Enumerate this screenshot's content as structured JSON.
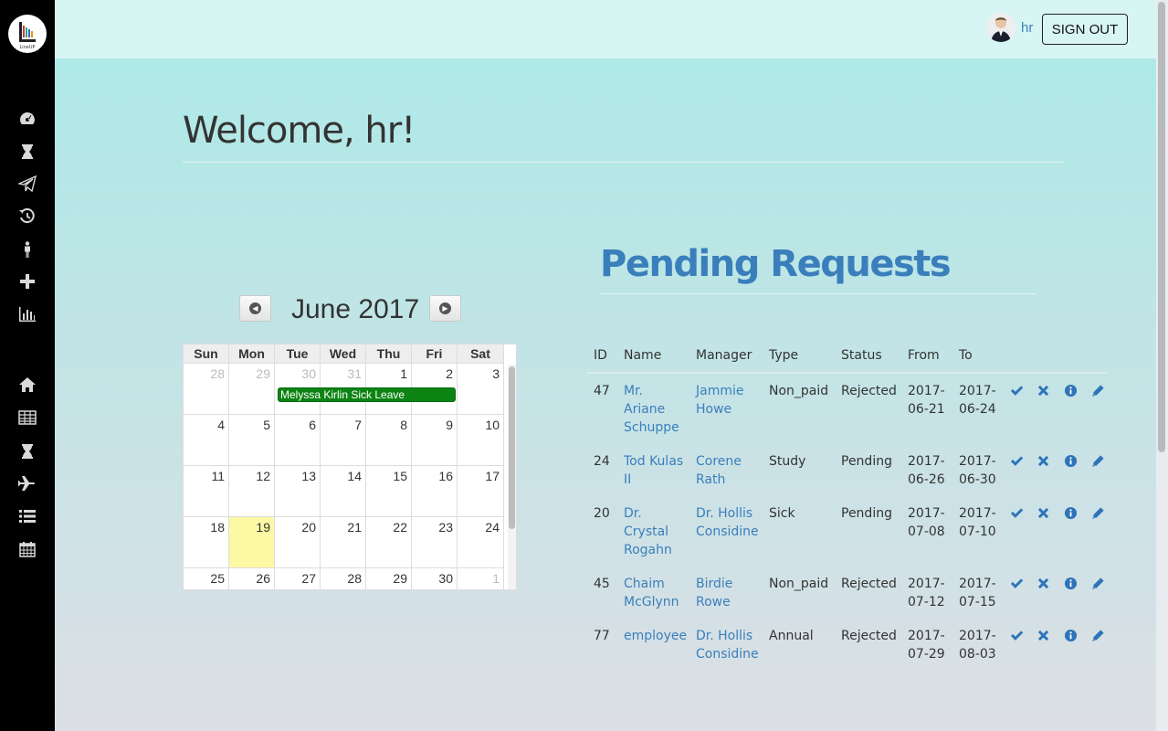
{
  "header": {
    "user_name": "hr",
    "sign_out_label": "SIGN OUT"
  },
  "sidebar": {
    "icons_top": [
      "dashboard-icon",
      "hourglass-icon",
      "paper-plane-icon",
      "history-icon",
      "person-icon",
      "plus-icon",
      "bar-chart-icon"
    ],
    "icons_bottom": [
      "home-icon",
      "table-icon",
      "hourglass-icon",
      "plane-icon",
      "list-icon",
      "calendar-icon"
    ]
  },
  "main": {
    "welcome": "Welcome, hr!"
  },
  "calendar": {
    "title": "June 2017",
    "weekdays": [
      "Sun",
      "Mon",
      "Tue",
      "Wed",
      "Thu",
      "Fri",
      "Sat"
    ],
    "weeks": [
      [
        "28",
        "29",
        "30",
        "31",
        "1",
        "2",
        "3"
      ],
      [
        "4",
        "5",
        "6",
        "7",
        "8",
        "9",
        "10"
      ],
      [
        "11",
        "12",
        "13",
        "14",
        "15",
        "16",
        "17"
      ],
      [
        "18",
        "19",
        "20",
        "21",
        "22",
        "23",
        "24"
      ],
      [
        "25",
        "26",
        "27",
        "28",
        "29",
        "30",
        "1"
      ]
    ],
    "event": "Melyssa Kirlin Sick Leave",
    "event_color": "#0c8313",
    "today_color": "#fcf8a4"
  },
  "pending": {
    "title": "Pending Requests",
    "columns": [
      "ID",
      "Name",
      "Manager",
      "Type",
      "Status",
      "From",
      "To"
    ],
    "rows": [
      {
        "id": "47",
        "name": [
          "Mr.",
          "Ariane",
          "Schuppe"
        ],
        "manager": [
          "Jammie",
          "Howe"
        ],
        "type": "Non_paid",
        "status": "Rejected",
        "from": [
          "2017-",
          "06-21"
        ],
        "to": [
          "2017-",
          "06-24"
        ]
      },
      {
        "id": "24",
        "name": [
          "Tod Kulas",
          "II"
        ],
        "manager": [
          "Corene",
          "Rath"
        ],
        "type": "Study",
        "status": "Pending",
        "from": [
          "2017-",
          "06-26"
        ],
        "to": [
          "2017-",
          "06-30"
        ]
      },
      {
        "id": "20",
        "name": [
          "Dr.",
          "Crystal",
          "Rogahn"
        ],
        "manager": [
          "Dr. Hollis",
          "Considine"
        ],
        "type": "Sick",
        "status": "Pending",
        "from": [
          "2017-",
          "07-08"
        ],
        "to": [
          "2017-",
          "07-10"
        ]
      },
      {
        "id": "45",
        "name": [
          "Chaim",
          "McGlynn"
        ],
        "manager": [
          "Birdie",
          "Rowe"
        ],
        "type": "Non_paid",
        "status": "Rejected",
        "from": [
          "2017-",
          "07-12"
        ],
        "to": [
          "2017-",
          "07-15"
        ]
      },
      {
        "id": "77",
        "name": [
          "employee"
        ],
        "manager": [
          "Dr. Hollis",
          "Considine"
        ],
        "type": "Annual",
        "status": "Rejected",
        "from": [
          "2017-",
          "07-29"
        ],
        "to": [
          "2017-",
          "08-03"
        ]
      }
    ],
    "actions": [
      "approve-icon",
      "reject-icon",
      "info-icon",
      "edit-icon"
    ],
    "link_color": "#3a7fbb"
  }
}
